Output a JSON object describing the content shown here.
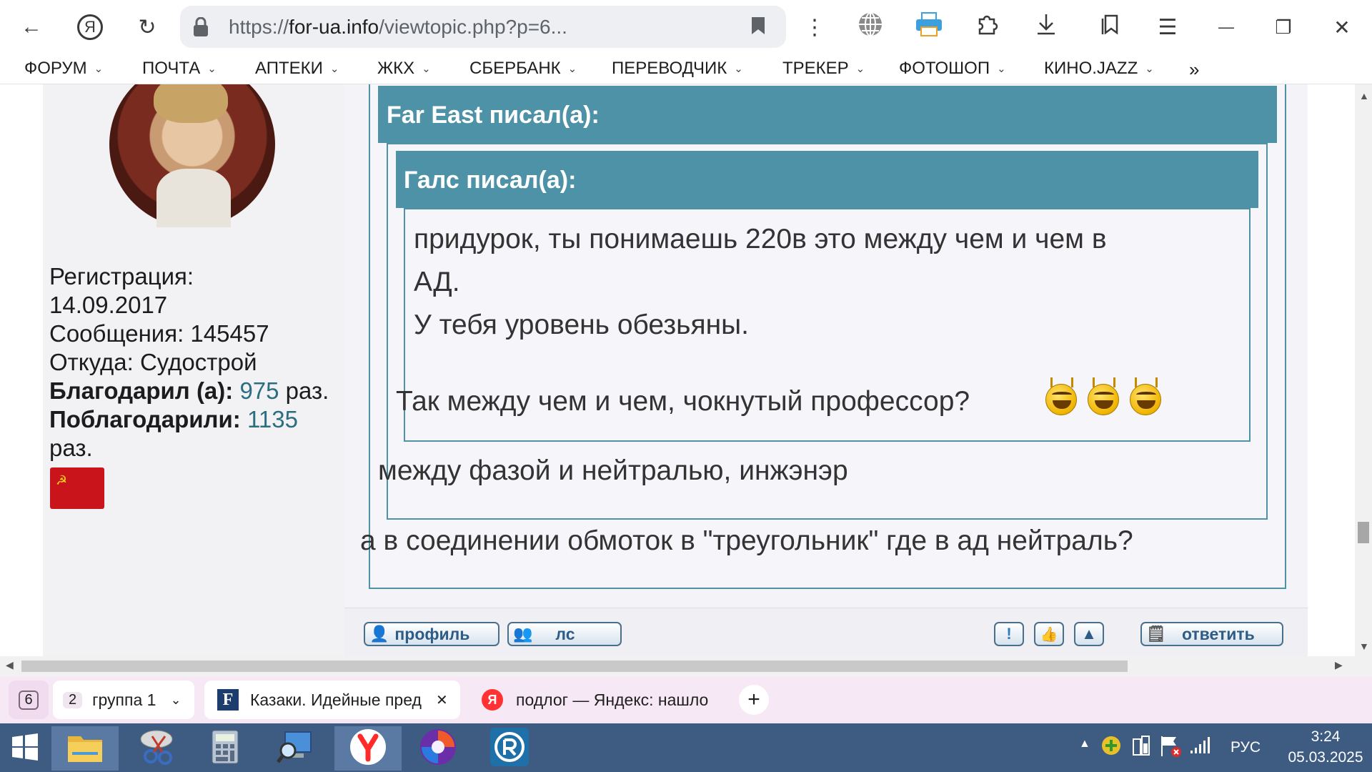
{
  "browser": {
    "url_prefix": "https://",
    "url_domain": "for-ua.info",
    "url_rest": "/viewtopic.php?p=6...",
    "back_glyph": "←",
    "yandex_glyph": "Я",
    "reload_glyph": "↻",
    "menu_dots": "⋮",
    "menu_lines": "☰",
    "minimize": "—",
    "restore": "❐",
    "close": "✕"
  },
  "bookmarks": [
    {
      "label": "ФОРУМ"
    },
    {
      "label": "ПОЧТА"
    },
    {
      "label": "АПТЕКИ"
    },
    {
      "label": "ЖКХ"
    },
    {
      "label": "СБЕРБАНК"
    },
    {
      "label": "ПЕРЕВОДЧИК"
    },
    {
      "label": "ТРЕКЕР"
    },
    {
      "label": "ФОТОШОП"
    },
    {
      "label": "КИНО.JAZZ"
    }
  ],
  "bookmarks_more": "»",
  "chevron": "⌄",
  "user": {
    "reg_label": "Регистрация:",
    "reg_date": "14.09.2017",
    "messages": "Сообщения: 145457",
    "from": "Откуда: Судострой",
    "thanked_label": "Благодарил (а):",
    "thanked_count": "975",
    "thanked_unit": "раз.",
    "was_thanked_label": "Поблагодарили:",
    "was_thanked_count": "1135",
    "was_thanked_unit": "раз.",
    "flag_symbol": "☭"
  },
  "post": {
    "quote_outer_author": "Far East писал(а):",
    "quote_inner_author": "Галс писал(а):",
    "quote_inner_line1": "придурок, ты понимаешь 220в это между чем и чем в",
    "quote_inner_line2": "АД.",
    "quote_inner_line3": "У тебя уровень обезьяны.",
    "quote_middle_text": "Так между чем и чем, чокнутый профессор?",
    "quote_outer_text": "между фазой и нейтралью, инжэнэр",
    "reply_text": "а в соединении обмоток в \"треугольник\" где в ад нейтраль?"
  },
  "post_buttons": {
    "profile": "профиль",
    "pm": "лс",
    "report": "!",
    "like": "👍",
    "up": "▲",
    "reply": "ответить"
  },
  "tabs": {
    "count": "6",
    "group_count": "2",
    "group_label": "группа 1",
    "tab1_icon": "F",
    "tab1_title": "Казаки. Идейные пред",
    "tab1_close": "✕",
    "tab2_icon": "Я",
    "tab2_title": "подлог — Яндекс: нашло",
    "new_tab": "+"
  },
  "taskbar": {
    "tray_arrow": "▲",
    "lang": "РУС",
    "time": "3:24",
    "date": "05.03.2025"
  },
  "colors": {
    "quote_header": "#4d92a6",
    "link_number": "#2b6e80",
    "taskbar": "#3e5c82",
    "tab_bar": "#f6e8f4"
  }
}
